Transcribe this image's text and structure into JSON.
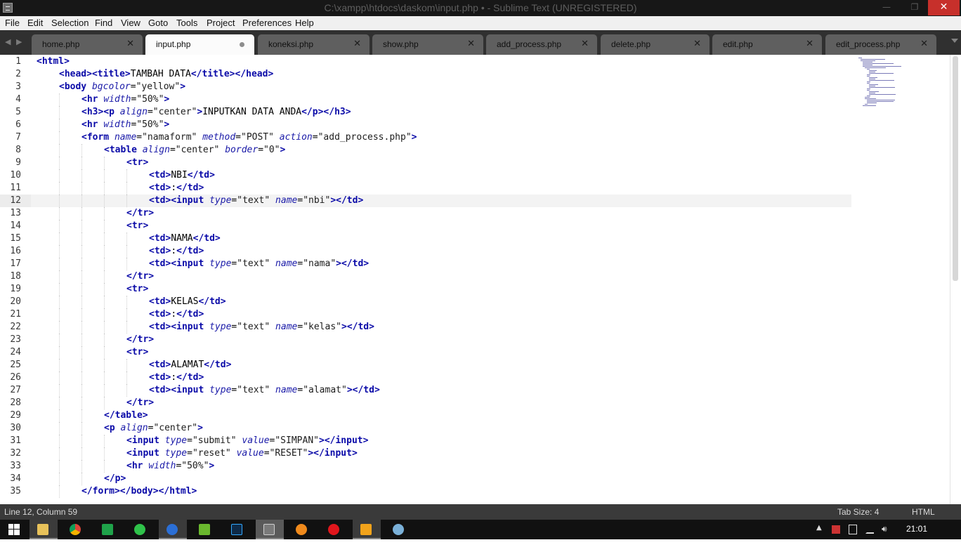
{
  "window": {
    "title": "C:\\xampp\\htdocs\\daskom\\input.php • - Sublime Text (UNREGISTERED)",
    "minimize": "—",
    "maximize": "❐",
    "close": "✕"
  },
  "menu": [
    "File",
    "Edit",
    "Selection",
    "Find",
    "View",
    "Goto",
    "Tools",
    "Project",
    "Preferences",
    "Help"
  ],
  "tabs": [
    {
      "label": "home.php",
      "close": "✕"
    },
    {
      "label": "input.php",
      "close": "●",
      "active": true
    },
    {
      "label": "koneksi.php",
      "close": "✕"
    },
    {
      "label": "show.php",
      "close": "✕"
    },
    {
      "label": "add_process.php",
      "close": "✕"
    },
    {
      "label": "delete.php",
      "close": "✕"
    },
    {
      "label": "edit.php",
      "close": "✕"
    },
    {
      "label": "edit_process.php",
      "close": "✕"
    }
  ],
  "tabnav": {
    "left": "◀",
    "right": "▶"
  },
  "lines": [
    {
      "n": "1",
      "indent": 0,
      "t": [
        [
          "tg",
          "<html>"
        ]
      ]
    },
    {
      "n": "2",
      "indent": 1,
      "t": [
        [
          "tg",
          "<head>"
        ],
        [
          "tg",
          "<title>"
        ],
        [
          "tx",
          "TAMBAH DATA"
        ],
        [
          "tg",
          "</title>"
        ],
        [
          "tg",
          "</head>"
        ]
      ]
    },
    {
      "n": "3",
      "indent": 1,
      "t": [
        [
          "tg",
          "<body "
        ],
        [
          "at",
          "bgcolor"
        ],
        [
          "tx",
          "="
        ],
        [
          "st",
          "\"yellow\""
        ],
        [
          "tg",
          ">"
        ]
      ]
    },
    {
      "n": "4",
      "indent": 2,
      "t": [
        [
          "tg",
          "<hr "
        ],
        [
          "at",
          "width"
        ],
        [
          "tx",
          "="
        ],
        [
          "st",
          "\"50%\""
        ],
        [
          "tg",
          ">"
        ]
      ]
    },
    {
      "n": "5",
      "indent": 2,
      "t": [
        [
          "tg",
          "<h3>"
        ],
        [
          "tg",
          "<p "
        ],
        [
          "at",
          "align"
        ],
        [
          "tx",
          "="
        ],
        [
          "st",
          "\"center\""
        ],
        [
          "tg",
          ">"
        ],
        [
          "tx",
          "INPUTKAN DATA ANDA"
        ],
        [
          "tg",
          "</p>"
        ],
        [
          "tg",
          "</h3>"
        ]
      ]
    },
    {
      "n": "6",
      "indent": 2,
      "t": [
        [
          "tg",
          "<hr "
        ],
        [
          "at",
          "width"
        ],
        [
          "tx",
          "="
        ],
        [
          "st",
          "\"50%\""
        ],
        [
          "tg",
          ">"
        ]
      ]
    },
    {
      "n": "7",
      "indent": 2,
      "t": [
        [
          "tg",
          "<form "
        ],
        [
          "at",
          "name"
        ],
        [
          "tx",
          "="
        ],
        [
          "st",
          "\"namaform\" "
        ],
        [
          "at",
          "method"
        ],
        [
          "tx",
          "="
        ],
        [
          "st",
          "\"POST\" "
        ],
        [
          "at",
          "action"
        ],
        [
          "tx",
          "="
        ],
        [
          "st",
          "\"add_process.php\""
        ],
        [
          "tg",
          ">"
        ]
      ]
    },
    {
      "n": "8",
      "indent": 3,
      "t": [
        [
          "tg",
          "<table "
        ],
        [
          "at",
          "align"
        ],
        [
          "tx",
          "="
        ],
        [
          "st",
          "\"center\" "
        ],
        [
          "at",
          "border"
        ],
        [
          "tx",
          "="
        ],
        [
          "st",
          "\"0\""
        ],
        [
          "tg",
          ">"
        ]
      ]
    },
    {
      "n": "9",
      "indent": 4,
      "t": [
        [
          "tg",
          "<tr>"
        ]
      ]
    },
    {
      "n": "10",
      "indent": 5,
      "t": [
        [
          "tg",
          "<td>"
        ],
        [
          "tx",
          "NBI"
        ],
        [
          "tg",
          "</td>"
        ]
      ]
    },
    {
      "n": "11",
      "indent": 5,
      "t": [
        [
          "tg",
          "<td>"
        ],
        [
          "tx",
          ":"
        ],
        [
          "tg",
          "</td>"
        ]
      ]
    },
    {
      "n": "12",
      "indent": 5,
      "cur": true,
      "t": [
        [
          "tg",
          "<td>"
        ],
        [
          "tg",
          "<input "
        ],
        [
          "at",
          "type"
        ],
        [
          "tx",
          "="
        ],
        [
          "st",
          "\"text\" "
        ],
        [
          "at",
          "name"
        ],
        [
          "tx",
          "="
        ],
        [
          "st",
          "\"nbi\""
        ],
        [
          "tg",
          ">"
        ],
        [
          "tg",
          "</td>"
        ]
      ]
    },
    {
      "n": "13",
      "indent": 4,
      "t": [
        [
          "tg",
          "</tr>"
        ]
      ]
    },
    {
      "n": "14",
      "indent": 4,
      "t": [
        [
          "tg",
          "<tr>"
        ]
      ]
    },
    {
      "n": "15",
      "indent": 5,
      "t": [
        [
          "tg",
          "<td>"
        ],
        [
          "tx",
          "NAMA"
        ],
        [
          "tg",
          "</td>"
        ]
      ]
    },
    {
      "n": "16",
      "indent": 5,
      "t": [
        [
          "tg",
          "<td>"
        ],
        [
          "tx",
          ":"
        ],
        [
          "tg",
          "</td>"
        ]
      ]
    },
    {
      "n": "17",
      "indent": 5,
      "t": [
        [
          "tg",
          "<td>"
        ],
        [
          "tg",
          "<input "
        ],
        [
          "at",
          "type"
        ],
        [
          "tx",
          "="
        ],
        [
          "st",
          "\"text\" "
        ],
        [
          "at",
          "name"
        ],
        [
          "tx",
          "="
        ],
        [
          "st",
          "\"nama\""
        ],
        [
          "tg",
          ">"
        ],
        [
          "tg",
          "</td>"
        ]
      ]
    },
    {
      "n": "18",
      "indent": 4,
      "t": [
        [
          "tg",
          "</tr>"
        ]
      ]
    },
    {
      "n": "19",
      "indent": 4,
      "t": [
        [
          "tg",
          "<tr>"
        ]
      ]
    },
    {
      "n": "20",
      "indent": 5,
      "t": [
        [
          "tg",
          "<td>"
        ],
        [
          "tx",
          "KELAS"
        ],
        [
          "tg",
          "</td>"
        ]
      ]
    },
    {
      "n": "21",
      "indent": 5,
      "t": [
        [
          "tg",
          "<td>"
        ],
        [
          "tx",
          ":"
        ],
        [
          "tg",
          "</td>"
        ]
      ]
    },
    {
      "n": "22",
      "indent": 5,
      "t": [
        [
          "tg",
          "<td>"
        ],
        [
          "tg",
          "<input "
        ],
        [
          "at",
          "type"
        ],
        [
          "tx",
          "="
        ],
        [
          "st",
          "\"text\" "
        ],
        [
          "at",
          "name"
        ],
        [
          "tx",
          "="
        ],
        [
          "st",
          "\"kelas\""
        ],
        [
          "tg",
          ">"
        ],
        [
          "tg",
          "</td>"
        ]
      ]
    },
    {
      "n": "23",
      "indent": 4,
      "t": [
        [
          "tg",
          "</tr>"
        ]
      ]
    },
    {
      "n": "24",
      "indent": 4,
      "t": [
        [
          "tg",
          "<tr>"
        ]
      ]
    },
    {
      "n": "25",
      "indent": 5,
      "t": [
        [
          "tg",
          "<td>"
        ],
        [
          "tx",
          "ALAMAT"
        ],
        [
          "tg",
          "</td>"
        ]
      ]
    },
    {
      "n": "26",
      "indent": 5,
      "t": [
        [
          "tg",
          "<td>"
        ],
        [
          "tx",
          ":"
        ],
        [
          "tg",
          "</td>"
        ]
      ]
    },
    {
      "n": "27",
      "indent": 5,
      "t": [
        [
          "tg",
          "<td>"
        ],
        [
          "tg",
          "<input "
        ],
        [
          "at",
          "type"
        ],
        [
          "tx",
          "="
        ],
        [
          "st",
          "\"text\" "
        ],
        [
          "at",
          "name"
        ],
        [
          "tx",
          "="
        ],
        [
          "st",
          "\"alamat\""
        ],
        [
          "tg",
          ">"
        ],
        [
          "tg",
          "</td>"
        ]
      ]
    },
    {
      "n": "28",
      "indent": 4,
      "t": [
        [
          "tg",
          "</tr>"
        ]
      ]
    },
    {
      "n": "29",
      "indent": 3,
      "t": [
        [
          "tg",
          "</table>"
        ]
      ]
    },
    {
      "n": "30",
      "indent": 3,
      "t": [
        [
          "tg",
          "<p "
        ],
        [
          "at",
          "align"
        ],
        [
          "tx",
          "="
        ],
        [
          "st",
          "\"center\""
        ],
        [
          "tg",
          ">"
        ]
      ]
    },
    {
      "n": "31",
      "indent": 4,
      "t": [
        [
          "tg",
          "<input "
        ],
        [
          "at",
          "type"
        ],
        [
          "tx",
          "="
        ],
        [
          "st",
          "\"submit\" "
        ],
        [
          "at",
          "value"
        ],
        [
          "tx",
          "="
        ],
        [
          "st",
          "\"SIMPAN\""
        ],
        [
          "tg",
          ">"
        ],
        [
          "tg",
          "</input>"
        ]
      ]
    },
    {
      "n": "32",
      "indent": 4,
      "t": [
        [
          "tg",
          "<input "
        ],
        [
          "at",
          "type"
        ],
        [
          "tx",
          "="
        ],
        [
          "st",
          "\"reset\" "
        ],
        [
          "at",
          "value"
        ],
        [
          "tx",
          "="
        ],
        [
          "st",
          "\"RESET\""
        ],
        [
          "tg",
          ">"
        ],
        [
          "tg",
          "</input>"
        ]
      ]
    },
    {
      "n": "33",
      "indent": 4,
      "t": [
        [
          "tg",
          "<hr "
        ],
        [
          "at",
          "width"
        ],
        [
          "tx",
          "="
        ],
        [
          "st",
          "\"50%\""
        ],
        [
          "tg",
          ">"
        ]
      ]
    },
    {
      "n": "34",
      "indent": 3,
      "t": [
        [
          "tg",
          "</p>"
        ]
      ]
    },
    {
      "n": "35",
      "indent": 2,
      "t": [
        [
          "tg",
          "</form>"
        ],
        [
          "tg",
          "</body>"
        ],
        [
          "tg",
          "</html>"
        ]
      ]
    }
  ],
  "status": {
    "position": "Line 12, Column 59",
    "tab_size": "Tab Size: 4",
    "syntax": "HTML"
  },
  "taskbar": {
    "clock": "21:01",
    "apps": [
      "file-explorer",
      "chrome",
      "calculator",
      "line",
      "app-blue",
      "app-green",
      "photoshop",
      "sublime-text",
      "app-orange",
      "opera",
      "media-player",
      "paint"
    ]
  },
  "colors": {
    "tag": "#0a0aa8",
    "attr": "#1a1aa8",
    "close_button": "#c7302b",
    "status_bar": "#3a3a3a",
    "tab_bar": "#303030"
  }
}
